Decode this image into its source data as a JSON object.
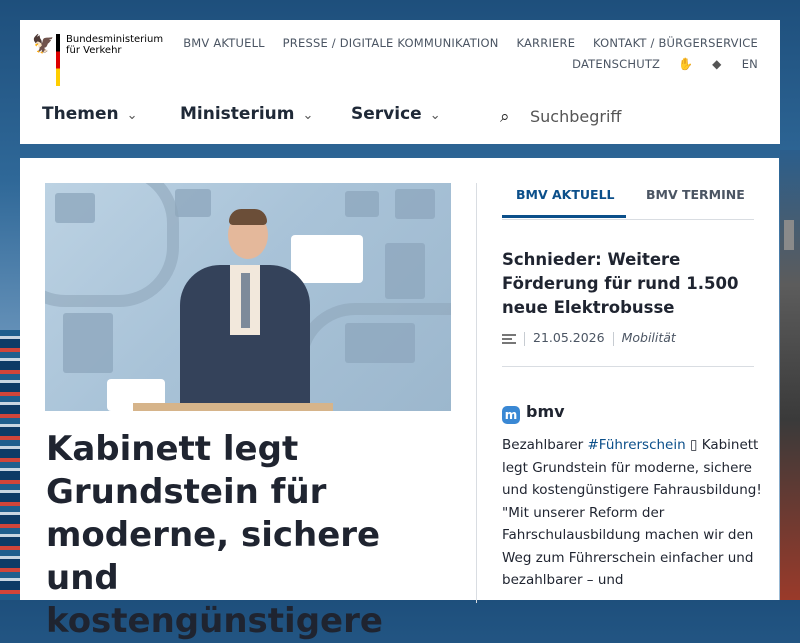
{
  "header": {
    "logo_text": "Bundesministerium für Verkehr",
    "top_links": [
      "BMV AKTUELL",
      "PRESSE / DIGITALE KOMMUNIKATION",
      "KARRIERE",
      "KONTAKT / BÜRGERSERVICE"
    ],
    "datenschutz": "DATENSCHUTZ",
    "lang": "EN",
    "icons": [
      "sign-language-icon",
      "easy-language-icon"
    ],
    "nav": {
      "themen": "Themen",
      "ministerium": "Ministerium",
      "service": "Service"
    },
    "search_placeholder": "Suchbegriff"
  },
  "hero": {
    "headline": "Kabinett legt Grundstein für moderne, sichere und kostengünstigere"
  },
  "sidebar": {
    "tabs": [
      "BMV AKTUELL",
      "BMV TERMINE"
    ],
    "news": {
      "title": "Schnieder: Weitere Förderung für rund 1.500 neue Elektrobusse",
      "date": "21.05.2026",
      "category": "Mobilität"
    },
    "mastodon": {
      "account": "bmv",
      "post_prefix": "Bezahlbarer ",
      "post_hashtag": "#Führerschein",
      "post_glyph": "▯",
      "post_body": " Kabinett legt Grundstein für moderne, sichere und kostengünstigere Fahrausbildung! \"Mit unserer Reform der Fahrschulausbildung machen wir den Weg zum Führerschein einfacher und bezahlbarer – und"
    }
  },
  "colors": {
    "accent": "#0b4f8a",
    "text": "#1f2430",
    "flag_black": "#000000",
    "flag_red": "#dd0000",
    "flag_gold": "#ffce00"
  }
}
